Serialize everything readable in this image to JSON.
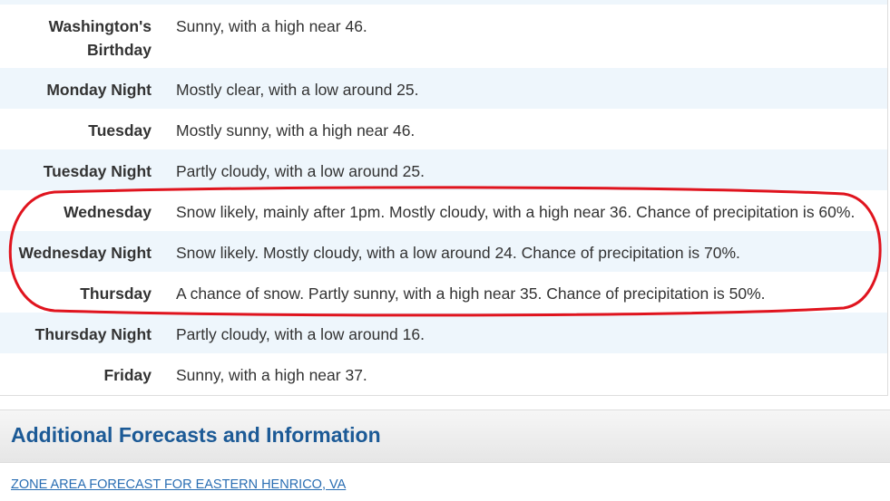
{
  "forecast": [
    {
      "period": "Washington's Birthday",
      "text": "Sunny, with a high near 46."
    },
    {
      "period": "Monday Night",
      "text": "Mostly clear, with a low around 25."
    },
    {
      "period": "Tuesday",
      "text": "Mostly sunny, with a high near 46."
    },
    {
      "period": "Tuesday Night",
      "text": "Partly cloudy, with a low around 25."
    },
    {
      "period": "Wednesday",
      "text": "Snow likely, mainly after 1pm. Mostly cloudy, with a high near 36. Chance of precipitation is 60%."
    },
    {
      "period": "Wednesday Night",
      "text": "Snow likely. Mostly cloudy, with a low around 24. Chance of precipitation is 70%."
    },
    {
      "period": "Thursday",
      "text": "A chance of snow. Partly sunny, with a high near 35. Chance of precipitation is 50%."
    },
    {
      "period": "Thursday Night",
      "text": "Partly cloudy, with a low around 16."
    },
    {
      "period": "Friday",
      "text": "Sunny, with a high near 37."
    }
  ],
  "additional": {
    "title": "Additional Forecasts and Information",
    "link": "ZONE AREA FORECAST FOR EASTERN HENRICO, VA"
  },
  "colors": {
    "highlight": "#e0141e",
    "heading": "#1c5a96",
    "row_alt": "#eef6fc"
  }
}
